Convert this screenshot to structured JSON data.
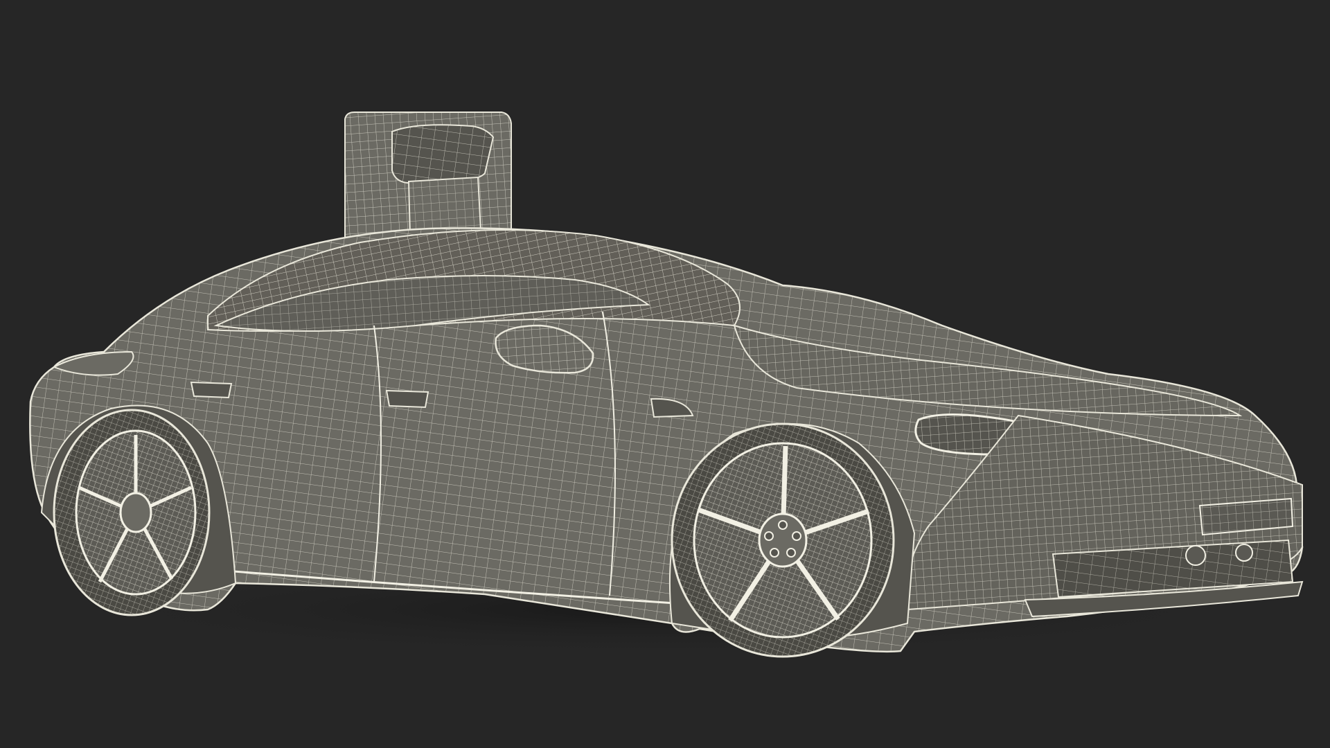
{
  "viewport": {
    "background": "#262626"
  },
  "scene": {
    "subject": "wireframe-sports-car-with-charging-station",
    "colors": {
      "body_fill": "#6b6a63",
      "body_fill_dark": "#55544e",
      "wire": "#e9e7da",
      "wire_dim": "#bdbbaf",
      "shadow": "#1c1c1b",
      "tire": "#4a4943",
      "glass": "#5f5e58"
    },
    "wire_density": {
      "fine": 12,
      "medium": 18
    }
  }
}
